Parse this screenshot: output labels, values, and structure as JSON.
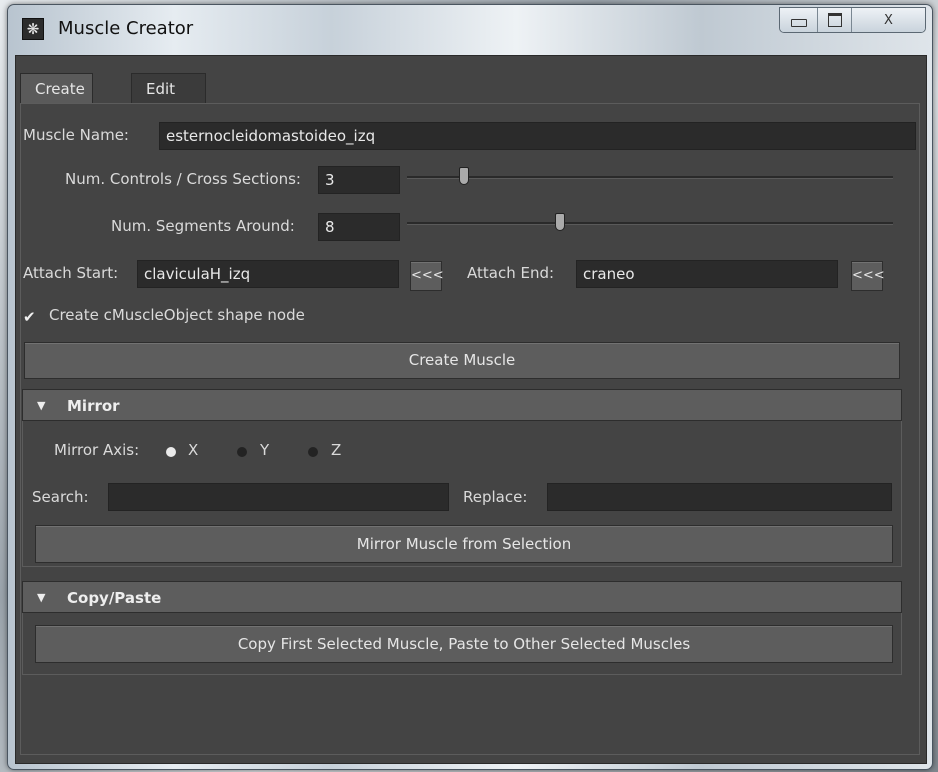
{
  "window": {
    "title": "Muscle Creator",
    "app_icon": "maya-logo-icon"
  },
  "caption_buttons": [
    "minimize-icon",
    "maximize-icon",
    "close-icon"
  ],
  "close_glyph": "X",
  "tabs": [
    {
      "label": "Create",
      "active": true
    },
    {
      "label": "Edit",
      "active": false
    }
  ],
  "create": {
    "muscle_name": {
      "label": "Muscle Name:",
      "value": "esternocleidomastoideo_izq"
    },
    "num_controls": {
      "label": "Num. Controls / Cross Sections:",
      "value": "3",
      "slider_fraction": 0.11
    },
    "num_segments": {
      "label": "Num. Segments Around:",
      "value": "8",
      "slider_fraction": 0.31
    },
    "attach_start": {
      "label": "Attach Start:",
      "value": "claviculaH_izq",
      "button": "<<<"
    },
    "attach_end": {
      "label": "Attach End:",
      "value": "craneo",
      "button": "<<<"
    },
    "create_shape_node": {
      "label": "Create cMuscleObject shape node",
      "checked": true
    },
    "create_button": "Create Muscle"
  },
  "mirror": {
    "header": "Mirror",
    "axis_label": "Mirror Axis:",
    "axes": [
      {
        "label": "X",
        "selected": true
      },
      {
        "label": "Y",
        "selected": false
      },
      {
        "label": "Z",
        "selected": false
      }
    ],
    "search_label": "Search:",
    "search_value": "",
    "replace_label": "Replace:",
    "replace_value": "",
    "button": "Mirror Muscle from Selection"
  },
  "copy_paste": {
    "header": "Copy/Paste",
    "button": "Copy First Selected Muscle, Paste to Other Selected Muscles"
  }
}
